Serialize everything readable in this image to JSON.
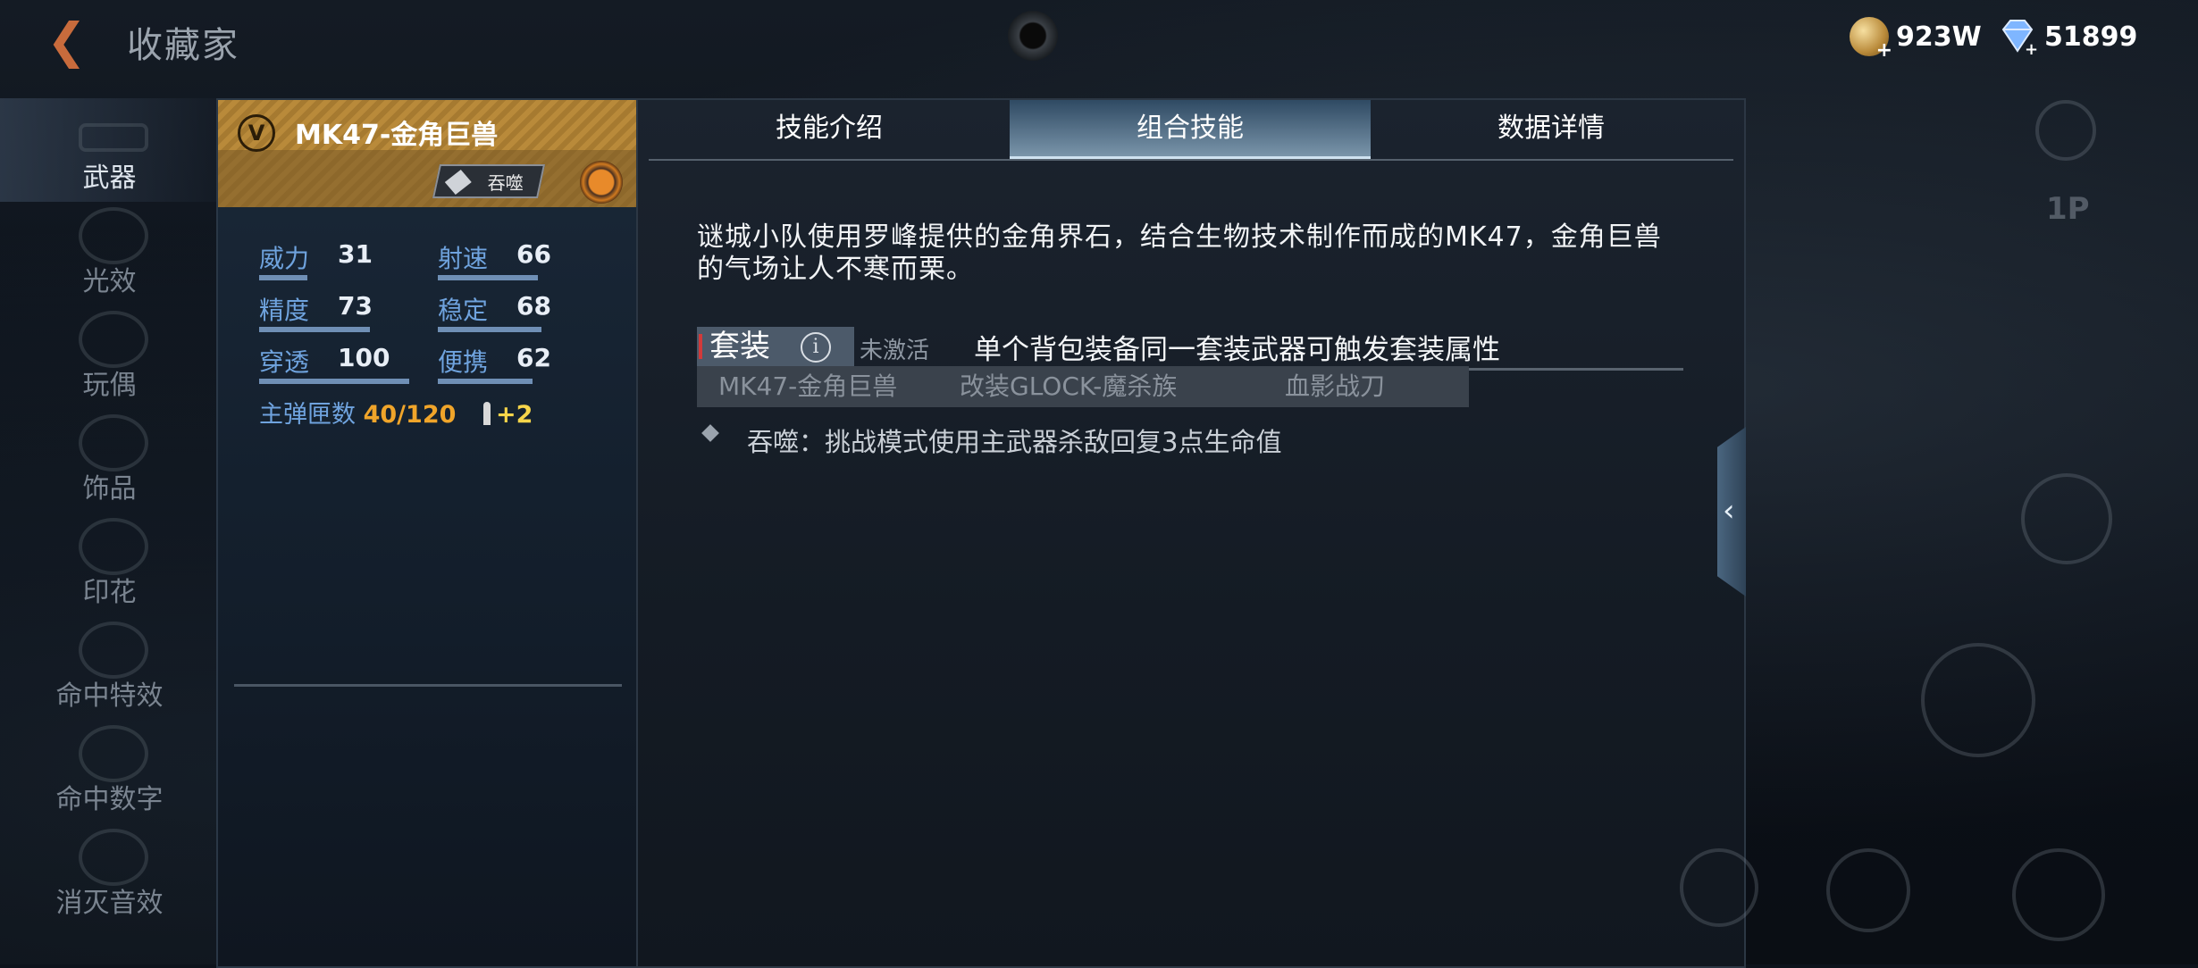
{
  "header": {
    "title": "收藏家",
    "coins": "923W",
    "gems": "51899"
  },
  "sidebar": {
    "items": [
      {
        "label": "武器",
        "active": true
      },
      {
        "label": "光效"
      },
      {
        "label": "玩偶"
      },
      {
        "label": "饰品"
      },
      {
        "label": "印花"
      },
      {
        "label": "命中特效"
      },
      {
        "label": "命中数字"
      },
      {
        "label": "消灭音效"
      }
    ]
  },
  "weapon": {
    "badge": "V",
    "name": "MK47-金角巨兽",
    "skill_tag": "吞噬",
    "stats": [
      {
        "name": "威力",
        "value": "31"
      },
      {
        "name": "射速",
        "value": "66"
      },
      {
        "name": "精度",
        "value": "73"
      },
      {
        "name": "稳定",
        "value": "68"
      },
      {
        "name": "穿透",
        "value": "100"
      },
      {
        "name": "便携",
        "value": "62"
      }
    ],
    "ammo_label": "主弹匣数",
    "ammo_current": "40",
    "ammo_total": "/120",
    "ammo_bonus": "+2"
  },
  "tabs": [
    {
      "label": "技能介绍"
    },
    {
      "label": "组合技能",
      "active": true
    },
    {
      "label": "数据详情"
    }
  ],
  "detail": {
    "description": "谜城小队使用罗峰提供的金角界石，结合生物技术制作而成的MK47，金角巨兽的气场让人不寒而栗。",
    "set_label": "套装",
    "set_status": "未激活",
    "set_desc": "单个背包装备同一套装武器可触发套装属性",
    "members": [
      "MK47-金角巨兽",
      "改装GLOCK-魔杀族",
      "血影战刀"
    ],
    "effect": "吞噬：挑战模式使用主武器杀敌回复3点生命值"
  },
  "colors": {
    "accent_gold": "#b98a3a",
    "stat_label": "#6fa3de",
    "ammo_current": "#f0a52a",
    "active_tab": "#7d98ad"
  },
  "right_controls": {
    "player_tag": "1P"
  }
}
